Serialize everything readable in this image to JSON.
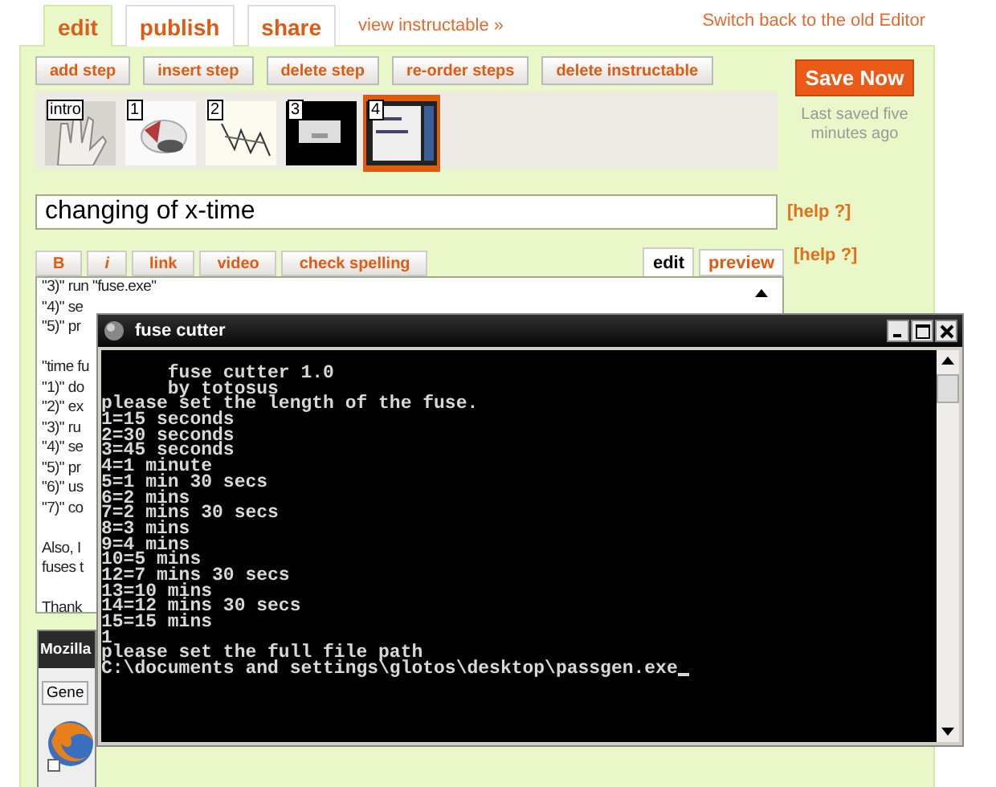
{
  "tabs": [
    {
      "label": "edit",
      "selected": true
    },
    {
      "label": "publish",
      "selected": false
    },
    {
      "label": "share",
      "selected": false
    }
  ],
  "view_link": "view instructable »",
  "switch_link": "Switch back to the old Editor",
  "step_buttons": [
    "add step",
    "insert step",
    "delete step",
    "re-order steps",
    "delete instructable"
  ],
  "save": {
    "label": "Save Now",
    "status": "Last saved five minutes ago"
  },
  "thumbnails": [
    {
      "label": "intro",
      "selected": false
    },
    {
      "label": "1",
      "selected": false
    },
    {
      "label": "2",
      "selected": false
    },
    {
      "label": "3",
      "selected": false
    },
    {
      "label": "4",
      "selected": true
    }
  ],
  "title_field": {
    "value": "changing of x-time",
    "help": "[help ?]"
  },
  "format_buttons": [
    "B",
    "i",
    "link",
    "video",
    "check spelling"
  ],
  "mode_tabs": [
    {
      "label": "edit",
      "selected": true
    },
    {
      "label": "preview",
      "selected": false
    }
  ],
  "editor_help": "[help ?]",
  "editor_paragraphs": [
    [
      "\"3)\" run \"fuse.exe\"",
      "\"4)\" se",
      "\"5)\" pr"
    ],
    [
      "\"time fu",
      "\"1)\" do",
      "\"2)\" ex",
      "\"3)\" ru",
      "\"4)\" se",
      "\"5)\" pr",
      "\"6)\" us",
      "\"7)\" co"
    ],
    [
      "Also, I",
      "fuses t"
    ],
    [
      "Thank"
    ]
  ],
  "back_window": {
    "title": "Mozilla",
    "tab": "Gene"
  },
  "console": {
    "title": "fuse cutter",
    "lines": [
      "      fuse cutter 1.0",
      "      by totosus",
      "please set the length of the fuse.",
      "1=15 seconds",
      "2=30 seconds",
      "3=45 seconds",
      "4=1 minute",
      "5=1 min 30 secs",
      "6=2 mins",
      "7=2 mins 30 secs",
      "8=3 mins",
      "9=4 mins",
      "10=5 mins",
      "12=7 mins 30 secs",
      "13=10 mins",
      "14=12 mins 30 secs",
      "15=15 mins",
      "1",
      "please set the full file path",
      "C:\\documents and settings\\glotos\\desktop\\passgen.exe"
    ],
    "cursor": true
  }
}
